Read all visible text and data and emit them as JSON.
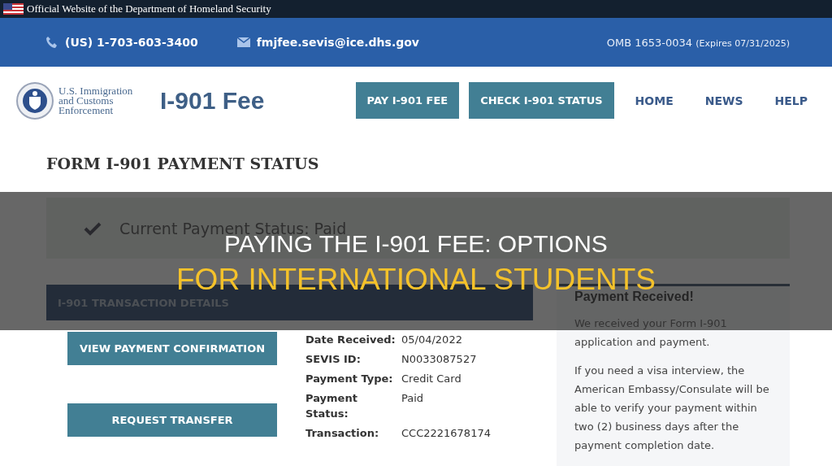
{
  "top_banner": {
    "text": "Official Website of the Department of Homeland Security"
  },
  "contact_bar": {
    "phone": "(US) 1-703-603-3400",
    "email": "fmjfee.sevis@ice.dhs.gov",
    "omb": "OMB 1653-0034",
    "expires": "(Expires 07/31/2025)"
  },
  "header": {
    "agency_lines": [
      "U.S. Immigration",
      "and Customs",
      "Enforcement"
    ],
    "site_title": "I-901 Fee",
    "nav": [
      {
        "label": "PAY I-901 FEE",
        "kind": "button"
      },
      {
        "label": "CHECK I-901 STATUS",
        "kind": "button"
      },
      {
        "label": "HOME",
        "kind": "link"
      },
      {
        "label": "NEWS",
        "kind": "link"
      },
      {
        "label": "HELP",
        "kind": "link"
      }
    ]
  },
  "page_title": "FORM I-901 PAYMENT STATUS",
  "status": {
    "text": "Current Payment Status: Paid"
  },
  "transaction": {
    "heading": "I-901 TRANSACTION DETAILS",
    "actions": [
      "VIEW PAYMENT CONFIRMATION",
      "REQUEST TRANSFER"
    ],
    "details": [
      {
        "label": "Date Received:",
        "value": "05/04/2022"
      },
      {
        "label": "SEVIS ID:",
        "value": "N0033087527"
      },
      {
        "label": "Payment Type:",
        "value": "Credit Card"
      },
      {
        "label": "Payment Status:",
        "value": "Paid"
      },
      {
        "label": "Transaction:",
        "value": "CCC2221678174"
      }
    ]
  },
  "notice": {
    "title": "Payment Received!",
    "paragraphs": [
      "We received your Form I-901 application and payment.",
      "If you need a visa interview, the American Embassy/Consulate will be able to verify your payment within two (2) business days after the payment completion date."
    ]
  },
  "overlay": {
    "line_1": "PAYING THE I-901 FEE: OPTIONS",
    "line_2": "FOR INTERNATIONAL STUDENTS"
  }
}
